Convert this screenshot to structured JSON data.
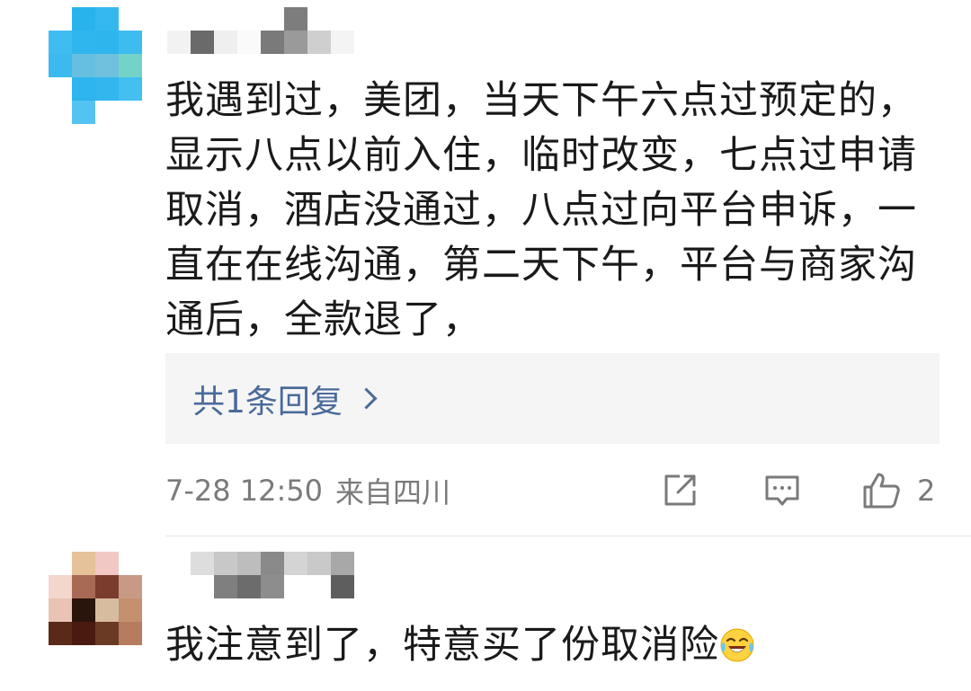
{
  "comments": [
    {
      "text": "我遇到过，美团，当天下午六点过预定的，显示八点以前入住，临时改变，七点过申请取消，酒店没通过，八点过向平台申诉，一直在在线沟通，第二天下午，平台与商家沟通后，全款退了，",
      "reply_summary": "共1条回复",
      "time": "7-28 12:50",
      "location": "来自四川",
      "like_count": "2",
      "icons": [
        "share-icon",
        "comment-icon",
        "thumbs-up-icon",
        "chevron-right-icon"
      ],
      "colors": {
        "link": "#4a6a9a",
        "meta": "#7a7a7a",
        "reply_bg": "#f5f5f5"
      }
    },
    {
      "text": "我注意到了，特意买了份取消险",
      "emoji": "laughing-crying-emoji"
    }
  ]
}
